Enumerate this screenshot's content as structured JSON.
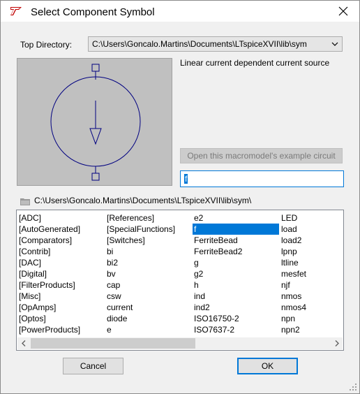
{
  "window": {
    "title": "Select Component Symbol",
    "close_label": "×"
  },
  "top_directory": {
    "label": "Top Directory:",
    "value": "C:\\Users\\Goncalo.Martins\\Documents\\LTspiceXVII\\lib\\sym"
  },
  "preview": {
    "description": "Linear current dependent current source"
  },
  "open_macromodel_button": "Open this macromodel's example circuit",
  "search": {
    "value": "f"
  },
  "current_path": "C:\\Users\\Goncalo.Martins\\Documents\\LTspiceXVII\\lib\\sym\\",
  "list": {
    "columns": [
      [
        "[ADC]",
        "[AutoGenerated]",
        "[Comparators]",
        "[Contrib]",
        "[DAC]",
        "[Digital]",
        "[FilterProducts]",
        "[Misc]",
        "[OpAmps]",
        "[Optos]",
        "[PowerProducts]"
      ],
      [
        "[References]",
        "[SpecialFunctions]",
        "[Switches]",
        "bi",
        "bi2",
        "bv",
        "cap",
        "csw",
        "current",
        "diode",
        "e"
      ],
      [
        "e2",
        "f",
        "FerriteBead",
        "FerriteBead2",
        "g",
        "g2",
        "h",
        "ind",
        "ind2",
        "ISO16750-2",
        "ISO7637-2"
      ],
      [
        "LED",
        "load",
        "load2",
        "lpnp",
        "ltline",
        "mesfet",
        "njf",
        "nmos",
        "nmos4",
        "npn",
        "npn2"
      ]
    ],
    "selected": "f"
  },
  "buttons": {
    "cancel": "Cancel",
    "ok": "OK"
  },
  "colors": {
    "accent": "#0078d7",
    "symbol": "#000080",
    "preview_bg": "#c0c0c0"
  }
}
